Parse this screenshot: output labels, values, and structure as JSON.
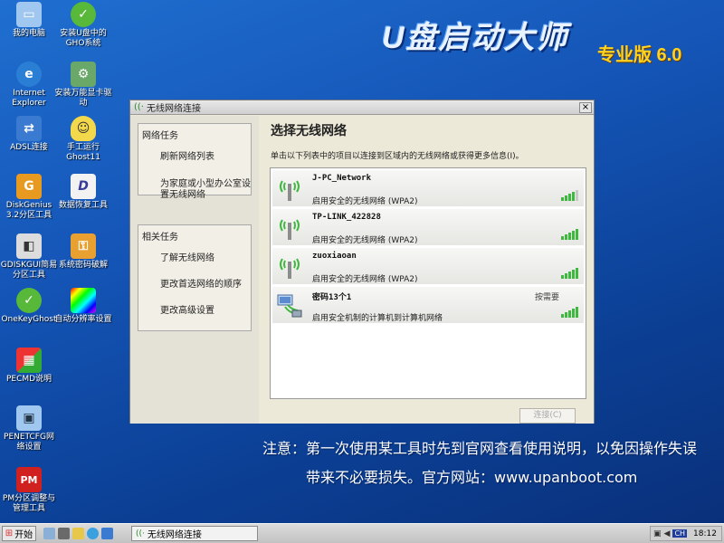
{
  "banner": {
    "title": "U盘启动大师",
    "edition": "专业版 6.0"
  },
  "desktop_icons": [
    {
      "id": "my-computer",
      "label": "我的电脑",
      "icon": "computer-icon",
      "color": "#9fc7f0"
    },
    {
      "id": "install-ghost",
      "label": "安装U盘中的GHO系统",
      "icon": "ghost-icon",
      "color": "#58b83a"
    },
    {
      "id": "ie",
      "label": "Internet Explorer",
      "icon": "ie-icon",
      "color": "#2a7fd4"
    },
    {
      "id": "install-nic",
      "label": "安装万能显卡驱动",
      "icon": "driver-icon",
      "color": "#6aa86a"
    },
    {
      "id": "adsl",
      "label": "ADSL连接",
      "icon": "adsl-icon",
      "color": "#3a7ad0"
    },
    {
      "id": "manual-ghost",
      "label": "手工运行Ghost11",
      "icon": "ghost-icon",
      "color": "#e8e8e8"
    },
    {
      "id": "diskgenius",
      "label": "DiskGenius 3.2分区工具",
      "icon": "diskgenius-icon",
      "color": "#e89a20"
    },
    {
      "id": "data-recovery",
      "label": "数据恢复工具",
      "icon": "recovery-icon",
      "color": "#f2f2f2"
    },
    {
      "id": "gdiskgui",
      "label": "GDISKGUI简易分区工具",
      "icon": "disk-icon",
      "color": "#dcdcdc"
    },
    {
      "id": "password",
      "label": "系统密码破解",
      "icon": "key-icon",
      "color": "#e8a030"
    },
    {
      "id": "onekeyghost",
      "label": "OneKeyGhost",
      "icon": "onekey-icon",
      "color": "#58b83a"
    },
    {
      "id": "resolution",
      "label": "自动分辨率设置",
      "icon": "resolution-icon",
      "color": "#404040"
    },
    {
      "id": "pecmd",
      "label": "PECMD说明",
      "icon": "pecmd-icon",
      "color": "#3a8ad0"
    },
    {
      "id": "penetcfg",
      "label": "PENETCFG网络设置",
      "icon": "network-icon",
      "color": "#9fc7f0"
    },
    {
      "id": "pm",
      "label": "PM分区调整与管理工具",
      "icon": "pm-icon",
      "color": "#d02020"
    }
  ],
  "window": {
    "title": "无线网络连接",
    "close_label": "×",
    "network_tasks": {
      "header": "网络任务",
      "items": [
        "刷新网络列表",
        "为家庭或小型办公室设置无线网络"
      ]
    },
    "related_tasks": {
      "header": "相关任务",
      "items": [
        "了解无线网络",
        "更改首选网络的顺序",
        "更改高级设置"
      ]
    },
    "main_title": "选择无线网络",
    "description": "单击以下列表中的项目以连接到区域内的无线网络或获得更多信息(I)。",
    "networks": [
      {
        "name": "J-PC_Network",
        "security": "启用安全的无线网络 (WPA2)",
        "status": "",
        "signal": 4,
        "icon": "wireless-antenna-icon"
      },
      {
        "name": "TP-LINK_422828",
        "security": "启用安全的无线网络 (WPA2)",
        "status": "",
        "signal": 5,
        "icon": "wireless-antenna-icon"
      },
      {
        "name": "zuoxiaoan",
        "security": "启用安全的无线网络 (WPA2)",
        "status": "",
        "signal": 5,
        "icon": "wireless-antenna-icon"
      },
      {
        "name": "密码13个1",
        "security": "启用安全机制的计算机到计算机网络",
        "status": "按需要",
        "signal": 5,
        "icon": "adhoc-computer-icon"
      }
    ],
    "connect_label": "连接(C)"
  },
  "notice": {
    "line1": "注意：第一次使用某工具时先到官网查看使用说明，以免因操作失误",
    "line2": "带来不必要损失。官方网站：www.upanboot.com"
  },
  "taskbar": {
    "start_label": "开始",
    "task_label": "无线网络连接",
    "tray_lang": "CH",
    "time": "18:12"
  }
}
